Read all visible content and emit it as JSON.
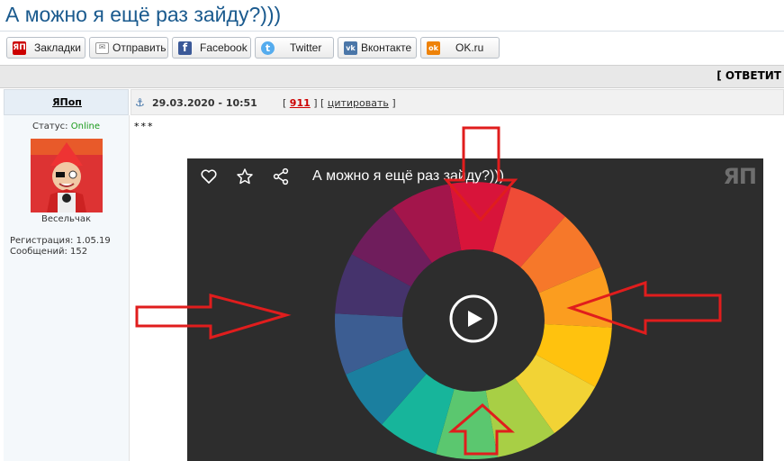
{
  "topic": {
    "title": "А можно я ещё раз зайду?)))"
  },
  "share": {
    "buttons": [
      {
        "label": "Закладки",
        "icon": "yap-bookmark-icon",
        "icon_text": "ЯП",
        "color": "#cc0000"
      },
      {
        "label": "Отправить",
        "icon": "envelope-icon",
        "icon_text": "✉",
        "color": "#777777"
      },
      {
        "label": "Facebook",
        "icon": "facebook-icon",
        "icon_text": "f",
        "color": "#3b5998"
      },
      {
        "label": "Twitter",
        "icon": "twitter-icon",
        "icon_text": "t",
        "color": "#55acee"
      },
      {
        "label": "Вконтакте",
        "icon": "vk-icon",
        "icon_text": "vk",
        "color": "#4a76a8"
      },
      {
        "label": "OK.ru",
        "icon": "ok-icon",
        "icon_text": "ok",
        "color": "#ee8208"
      }
    ]
  },
  "reply": {
    "label": "[ ОТВЕТИТ"
  },
  "post": {
    "author": "ЯПоп",
    "date": "29.03.2020 - 10:51",
    "number": "911",
    "quote_label": "цитировать",
    "text": "***",
    "status_label": "Статус:",
    "status_value": "Online",
    "rank": "Весельчак",
    "registration": "Регистрация: 1.05.19",
    "messages": "Сообщений: 152"
  },
  "video": {
    "title": "А можно я ещё раз зайду?)))",
    "logo": "ЯП",
    "icons": [
      "heart-icon",
      "star-icon",
      "share-icon",
      "play-icon"
    ]
  },
  "colors": {
    "link_blue": "#1a5a8e",
    "online_green": "#1a9a1a",
    "arrow_red": "#e01d1d",
    "player_bg": "#2d2d2d"
  }
}
